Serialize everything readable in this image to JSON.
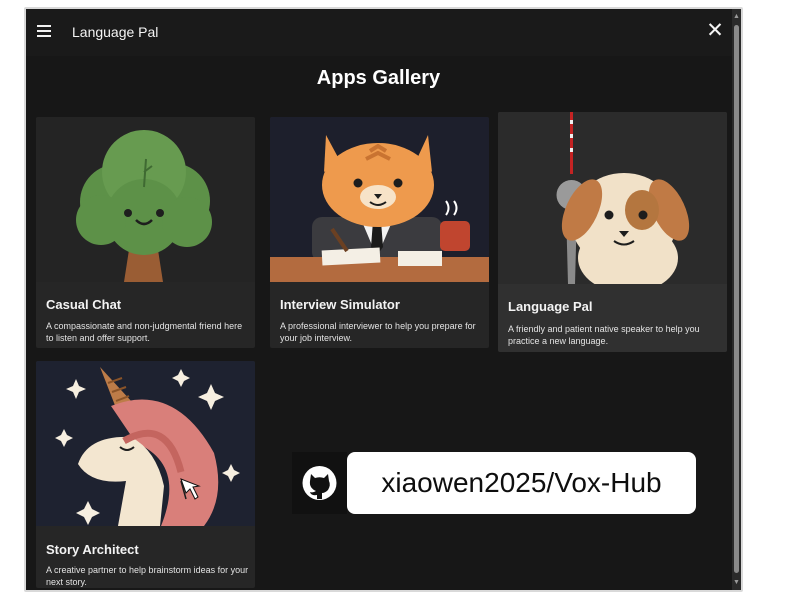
{
  "header": {
    "title": "Language Pal",
    "menu_icon": "menu-icon",
    "close_icon": "close-icon",
    "close_label": "✕"
  },
  "gallery": {
    "title": "Apps Gallery",
    "cards": [
      {
        "name": "Casual Chat",
        "description": "A compassionate and non-judgmental friend here to listen and offer support.",
        "icon": "tree-character"
      },
      {
        "name": "Interview Simulator",
        "description": "A professional interviewer to help you prepare for your job interview.",
        "icon": "cat-interviewer"
      },
      {
        "name": "Language Pal",
        "description": "A friendly and patient native speaker to help you practice a new language.",
        "icon": "dog-tv-tower"
      },
      {
        "name": "Story Architect",
        "description": "A creative partner to help brainstorm ideas for your next story.",
        "icon": "unicorn"
      }
    ]
  },
  "watermark": {
    "text": "xiaowen2025/Vox-Hub",
    "icon": "github-icon"
  },
  "scrollbar": {
    "up": "▲",
    "down": "▼"
  }
}
